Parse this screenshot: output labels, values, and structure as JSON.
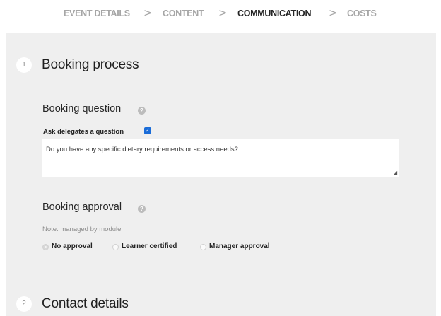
{
  "stepper": {
    "steps": [
      {
        "label": "EVENT DETAILS",
        "state": "inactive"
      },
      {
        "label": "CONTENT",
        "state": "inactive"
      },
      {
        "label": "COMMUNICATION",
        "state": "active"
      },
      {
        "label": "COSTS",
        "state": "inactive"
      }
    ],
    "separator": ">"
  },
  "sections": [
    {
      "number": "1",
      "title": "Booking process"
    },
    {
      "number": "2",
      "title": "Contact details"
    }
  ],
  "booking_question": {
    "title": "Booking question",
    "help_icon": "help-circle-icon",
    "ask_label": "Ask delegates a question",
    "ask_checked": true,
    "question_value": "Do you have any specific dietary requirements or access needs?"
  },
  "booking_approval": {
    "title": "Booking approval",
    "help_icon": "help-circle-icon",
    "note": "Note: managed by module",
    "options": [
      {
        "label": "No approval",
        "selected": true,
        "disabled": true
      },
      {
        "label": "Learner certified",
        "selected": false,
        "disabled": true
      },
      {
        "label": "Manager approval",
        "selected": false,
        "disabled": true
      }
    ]
  },
  "colors": {
    "panel_bg": "#efefef",
    "accent": "#1a6cd8",
    "inactive_text": "#a6a6a6"
  }
}
